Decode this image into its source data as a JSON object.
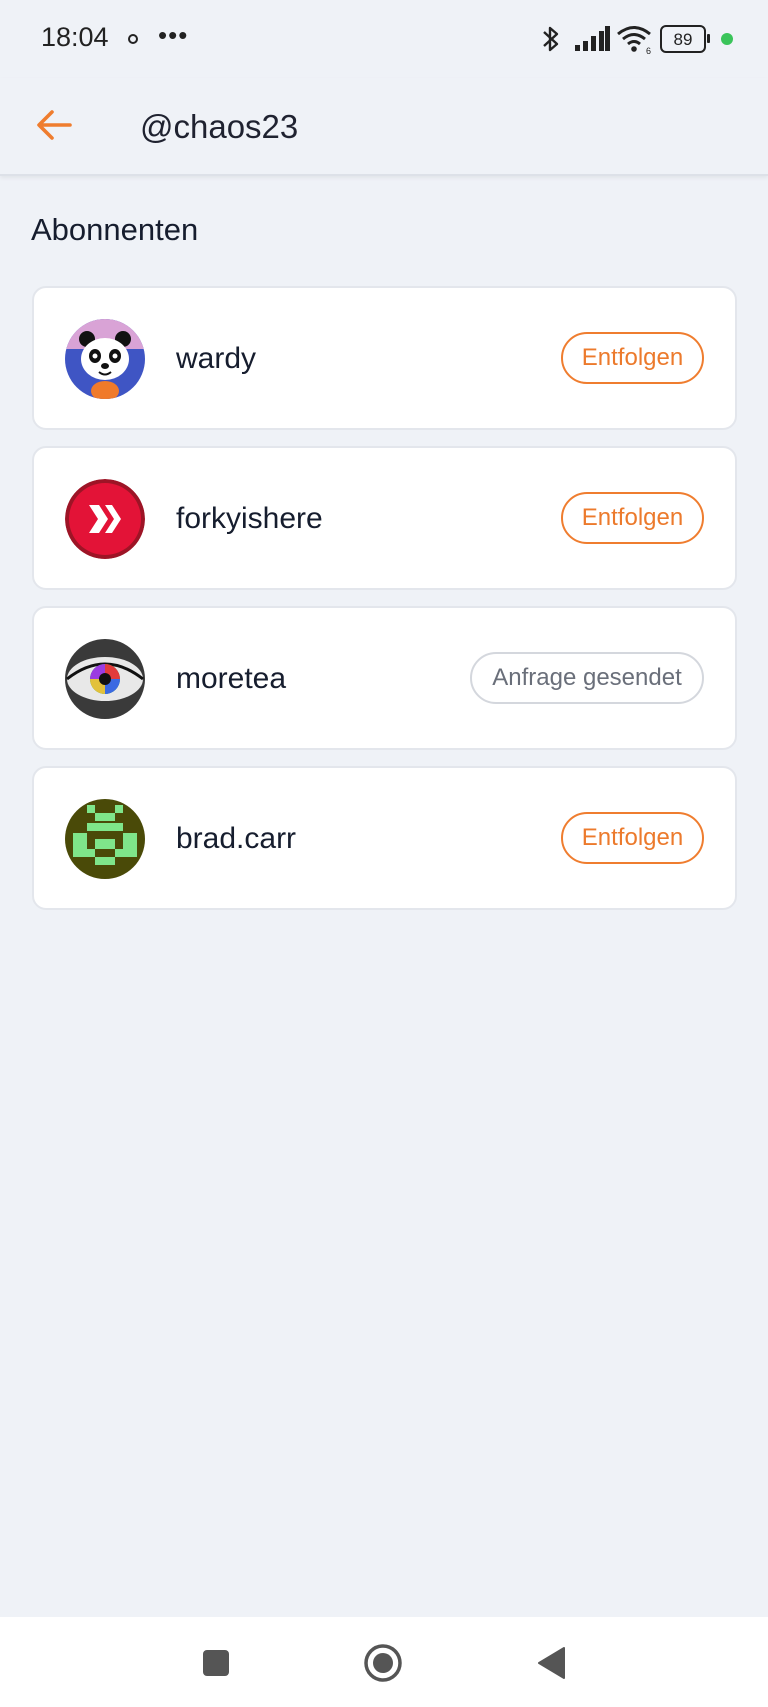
{
  "status_bar": {
    "time": "18:04",
    "more": "•••",
    "battery": "89",
    "icons": [
      "bluetooth-icon",
      "signal-icon",
      "wifi-icon",
      "battery-icon",
      "green-dot-icon"
    ]
  },
  "header": {
    "title": "@chaos23",
    "back_icon": "arrow-left-icon",
    "accent_color": "#ef7d2f"
  },
  "section": {
    "title": "Abonnenten"
  },
  "followers": [
    {
      "username": "wardy",
      "action": "Entfolgen",
      "state": "following",
      "avatar": "panda-avatar"
    },
    {
      "username": "forkyishere",
      "action": "Entfolgen",
      "state": "following",
      "avatar": "hive-logo-avatar"
    },
    {
      "username": "moretea",
      "action": "Anfrage gesendet",
      "state": "pending",
      "avatar": "eye-avatar"
    },
    {
      "username": "brad.carr",
      "action": "Entfolgen",
      "state": "following",
      "avatar": "pixel-avatar"
    }
  ],
  "nav_bar": {
    "icons": [
      "square-recents-icon",
      "circle-home-icon",
      "triangle-back-icon"
    ]
  },
  "colors": {
    "background": "#eff2f7",
    "card": "#ffffff",
    "accent": "#ef7d2f",
    "text": "#161d2e"
  }
}
